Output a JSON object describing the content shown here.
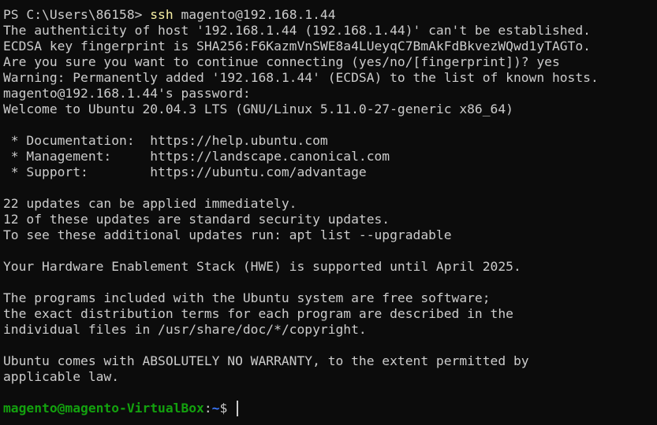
{
  "terminal": {
    "ps_prompt": "PS C:\\Users\\86158> ",
    "command_name": "ssh",
    "command_args": " magento@192.168.1.44",
    "output_lines": [
      "The authenticity of host '192.168.1.44 (192.168.1.44)' can't be established.",
      "ECDSA key fingerprint is SHA256:F6KazmVnSWE8a4LUeyqC7BmAkFdBkvezWQwd1yTAGTo.",
      "Are you sure you want to continue connecting (yes/no/[fingerprint])? yes",
      "Warning: Permanently added '192.168.1.44' (ECDSA) to the list of known hosts.",
      "magento@192.168.1.44's password:",
      "Welcome to Ubuntu 20.04.3 LTS (GNU/Linux 5.11.0-27-generic x86_64)",
      "",
      " * Documentation:  https://help.ubuntu.com",
      " * Management:     https://landscape.canonical.com",
      " * Support:        https://ubuntu.com/advantage",
      "",
      "22 updates can be applied immediately.",
      "12 of these updates are standard security updates.",
      "To see these additional updates run: apt list --upgradable",
      "",
      "Your Hardware Enablement Stack (HWE) is supported until April 2025.",
      "",
      "The programs included with the Ubuntu system are free software;",
      "the exact distribution terms for each program are described in the",
      "individual files in /usr/share/doc/*/copyright.",
      "",
      "Ubuntu comes with ABSOLUTELY NO WARRANTY, to the extent permitted by",
      "applicable law.",
      ""
    ],
    "shell_prompt": {
      "user_host": "magento@magento-VirtualBox",
      "colon": ":",
      "path": "~",
      "symbol": "$ "
    },
    "colors": {
      "background": "#0c0c0c",
      "foreground": "#cccccc",
      "command": "#f9f1a5",
      "prompt_user": "#13a10e",
      "prompt_path": "#3b78ff"
    }
  }
}
